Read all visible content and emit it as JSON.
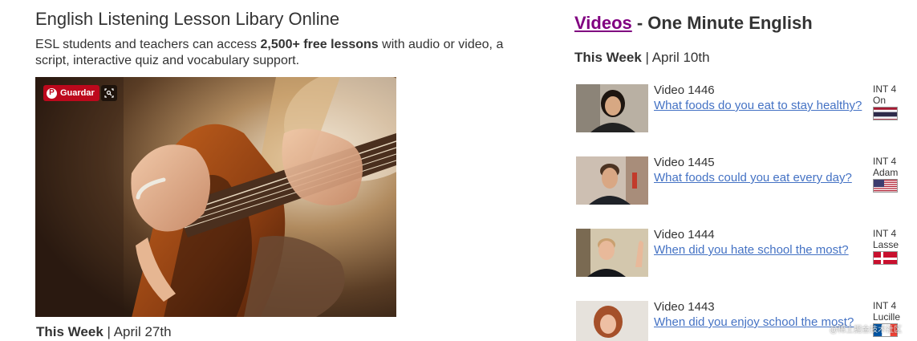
{
  "library": {
    "title": "English Listening Lesson Libary Online",
    "desc_before": "ESL students and teachers can access ",
    "desc_bold": "2,500+ free lessons",
    "desc_after": " with audio or video, a script, interactive quiz and vocabulary support.",
    "pin_label": "Guardar",
    "week_label": "This Week",
    "week_separator": " | ",
    "week_date": "April 27th"
  },
  "videos_section": {
    "link_text": "Videos",
    "title_rest": " - One Minute English",
    "week_label": "This Week",
    "week_separator": " | ",
    "week_date": "April 10th",
    "items": [
      {
        "number": "Video 1446",
        "question": "What foods do you eat to stay healthy?",
        "level": "INT 4",
        "speaker": "On",
        "flag": "thailand-flag-icon"
      },
      {
        "number": "Video 1445",
        "question": "What foods could you eat every day?",
        "level": "INT 4",
        "speaker": "Adam",
        "flag": "usa-flag-icon"
      },
      {
        "number": "Video 1444",
        "question": "When did you hate school the most?",
        "level": "INT 4",
        "speaker": "Lasse",
        "flag": "denmark-flag-icon"
      },
      {
        "number": "Video 1443",
        "question": "When did you enjoy school the most?",
        "level": "INT 4",
        "speaker": "Lucille",
        "flag": "france-flag-icon"
      }
    ]
  },
  "watermark": "@稀土掘金技术社区",
  "colors": {
    "link": "#4472c4",
    "visited_link": "#800080",
    "pinterest_red": "#bd081c",
    "text": "#333333"
  }
}
